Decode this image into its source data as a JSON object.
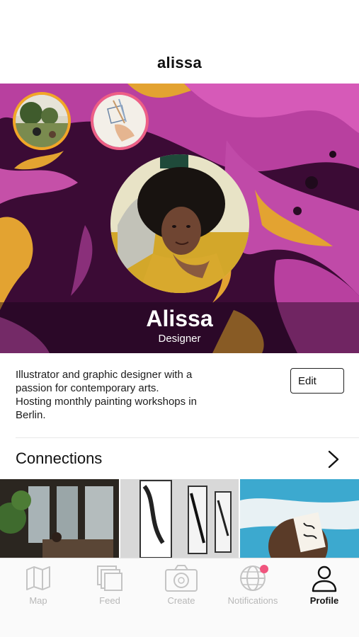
{
  "header": {
    "title": "alissa"
  },
  "profile": {
    "name": "Alissa",
    "role": "Designer",
    "avatar_icon": "profile-photo"
  },
  "stories": [
    {
      "icon": "story-park-photo",
      "ring_color": "#f2a627"
    },
    {
      "icon": "story-sketch-photo",
      "ring_color": "#ee5f86"
    }
  ],
  "bio": {
    "lines": [
      "Illustrator and graphic designer with a",
      "passion for contemporary arts.",
      "Hosting monthly painting workshops in",
      "Berlin."
    ],
    "edit_label": "Edit"
  },
  "connections": {
    "title": "Connections",
    "icon": "chevron-right-icon",
    "thumbnails": [
      "cafe-photo",
      "gallery-photo",
      "painting-photo"
    ]
  },
  "tabbar": {
    "tabs": [
      {
        "label": "Map",
        "icon": "map-icon",
        "active": false
      },
      {
        "label": "Feed",
        "icon": "feed-icon",
        "active": false
      },
      {
        "label": "Create",
        "icon": "camera-icon",
        "active": false
      },
      {
        "label": "Notifications",
        "icon": "globe-icon",
        "active": false,
        "badge": true
      },
      {
        "label": "Profile",
        "icon": "person-icon",
        "active": true
      }
    ]
  },
  "colors": {
    "story_ring_orange": "#f2a627",
    "story_ring_pink": "#ee5f86",
    "notification_badge": "#f0557e",
    "hero_magenta": "#c04aa8",
    "hero_gold": "#e3a331"
  }
}
